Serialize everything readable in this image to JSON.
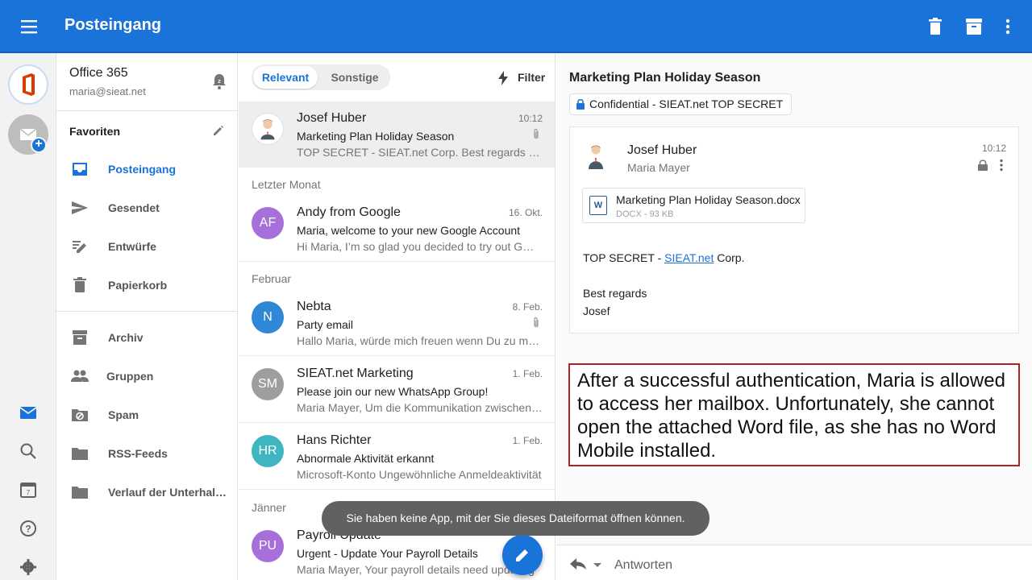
{
  "appbar": {
    "title": "Posteingang"
  },
  "account": {
    "name": "Office 365",
    "email": "maria@sieat.net"
  },
  "folders": {
    "favorites_label": "Favoriten",
    "items": [
      {
        "label": "Posteingang",
        "icon": "inbox-icon"
      },
      {
        "label": "Gesendet",
        "icon": "send-icon"
      },
      {
        "label": "Entwürfe",
        "icon": "drafts-icon"
      },
      {
        "label": "Papierkorb",
        "icon": "trash-icon"
      },
      {
        "label": "Archiv",
        "icon": "archive-icon"
      },
      {
        "label": "Gruppen",
        "icon": "groups-icon"
      },
      {
        "label": "Spam",
        "icon": "spam-icon"
      },
      {
        "label": "RSS-Feeds",
        "icon": "folder-icon"
      },
      {
        "label": "Verlauf der Unterhaltungen",
        "icon": "folder-icon"
      }
    ]
  },
  "list": {
    "tabs": {
      "relevant": "Relevant",
      "other": "Sonstige"
    },
    "filter_label": "Filter",
    "sections": [
      "Letzter Monat",
      "Februar",
      "Jänner"
    ],
    "messages": [
      {
        "sender": "Josef Huber",
        "date": "10:12",
        "subject": "Marketing Plan Holiday Season",
        "preview": "TOP SECRET - SIEAT.net Corp. Best regards Josef",
        "avatar": ""
      },
      {
        "sender": "Andy from Google",
        "date": "16. Okt.",
        "subject": "Maria, welcome to your new Google Account",
        "preview": "Hi Maria, I’m so glad you decided to try out Gmail. Here are",
        "avatar": "AF"
      },
      {
        "sender": "Nebta",
        "date": "8. Feb.",
        "subject": "Party email",
        "preview": "Hallo Maria, würde mich freuen wenn Du zu meiner Party",
        "avatar": "N"
      },
      {
        "sender": "SIEAT.net Marketing",
        "date": "1. Feb.",
        "subject": "Please join our new WhatsApp Group!",
        "preview": "Maria Mayer, Um die Kommunikation zwischen uns zu",
        "avatar": "SM"
      },
      {
        "sender": "Hans Richter",
        "date": "1. Feb.",
        "subject": "Abnormale Aktivität erkannt",
        "preview": "Microsoft-Konto Ungewöhnliche Anmeldeaktivität",
        "avatar": "HR"
      },
      {
        "sender": "Payroll Update",
        "date": "",
        "subject": "Urgent - Update Your Payroll Details",
        "preview": "Maria Mayer, Your payroll details need updating",
        "avatar": "PU"
      }
    ]
  },
  "toast": "Sie haben keine App, mit der Sie dieses Dateiformat öffnen können.",
  "reading": {
    "subject": "Marketing Plan Holiday Season",
    "label": "Confidential - SIEAT.net TOP SECRET",
    "from": "Josef Huber",
    "to": "Maria Mayer",
    "time": "10:12",
    "attachment": {
      "name": "Marketing Plan Holiday Season.docx",
      "meta": "DOCX - 93 KB",
      "icon_letter": "W"
    },
    "body": {
      "line1_prefix": "TOP SECRET - ",
      "line1_link": "SIEAT.net",
      "line1_suffix": " Corp.",
      "greeting": "Best regards",
      "signature": "Josef"
    },
    "reply_label": "Antworten"
  },
  "note": "After a successful authentication, Maria is allowed to access her mailbox. Unfortunately, she cannot open the attached Word file, as she has no Word Mobile installed.",
  "colors": {
    "accent": "#1a73d9",
    "note_border": "#b22222"
  }
}
